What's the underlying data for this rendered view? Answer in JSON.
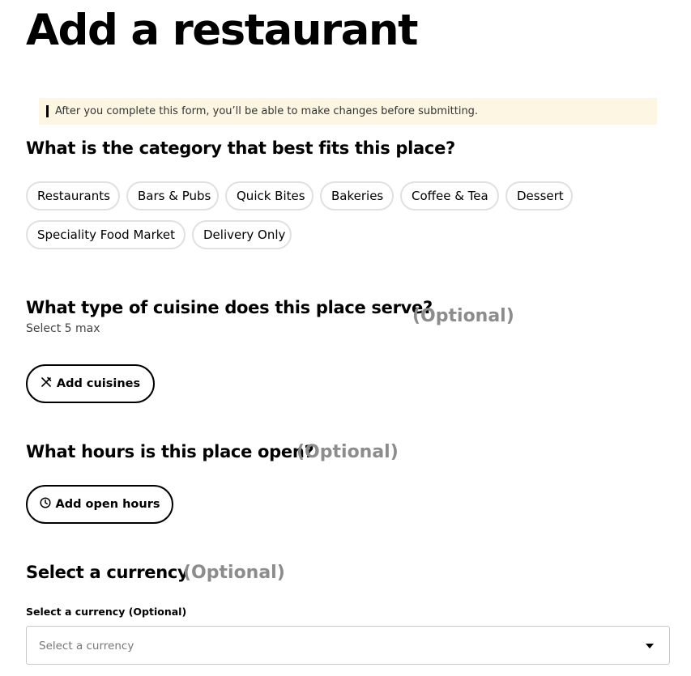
{
  "page": {
    "title": "Add a restaurant"
  },
  "notice": {
    "text": "After you complete this form, you’ll be able to make changes before submitting."
  },
  "category": {
    "question": "What is the category that best fits this place?",
    "options": [
      "Restaurants",
      "Bars & Pubs",
      "Quick Bites",
      "Bakeries",
      "Coffee & Tea",
      "Dessert",
      "Speciality Food Market",
      "Delivery Only"
    ]
  },
  "cuisine": {
    "question": "What type of cuisine does this place serve?",
    "optional": "(Optional)",
    "hint": "Select 5 max",
    "button_label": "Add cuisines",
    "button_icon": "utensils-icon"
  },
  "hours": {
    "question": "What hours is this place open?",
    "optional": "(Optional)",
    "button_label": "Add open hours",
    "button_icon": "clock-icon"
  },
  "currency": {
    "question": "Select a currency",
    "optional": "(Optional)",
    "field_label": "Select a currency (Optional)",
    "placeholder": "Select a currency",
    "icon": "caret-down-icon"
  },
  "colors": {
    "notice_bg": "#fdf6e3",
    "optional": "#8c8c8c",
    "chip_border": "#e0e0e0"
  }
}
